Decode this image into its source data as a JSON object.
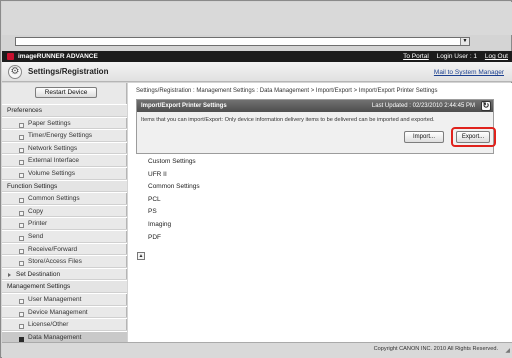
{
  "browser": {
    "dropdown_glyph": "▼"
  },
  "brand": {
    "name": "imageRUNNER ADVANCE",
    "to_portal": "To Portal",
    "login_user": "Login User : 1",
    "log_out": "Log Out"
  },
  "page": {
    "title": "Settings/Registration",
    "mail_link": "Mail to System Manager"
  },
  "sidebar": {
    "restart_label": "Restart Device",
    "items": [
      {
        "label": "Preferences",
        "kind": "header"
      },
      {
        "label": "Paper Settings",
        "kind": "sub"
      },
      {
        "label": "Timer/Energy Settings",
        "kind": "sub"
      },
      {
        "label": "Network Settings",
        "kind": "sub"
      },
      {
        "label": "External Interface",
        "kind": "sub"
      },
      {
        "label": "Volume Settings",
        "kind": "sub"
      },
      {
        "label": "Function Settings",
        "kind": "header"
      },
      {
        "label": "Common Settings",
        "kind": "sub"
      },
      {
        "label": "Copy",
        "kind": "sub"
      },
      {
        "label": "Printer",
        "kind": "sub"
      },
      {
        "label": "Send",
        "kind": "sub"
      },
      {
        "label": "Receive/Forward",
        "kind": "sub"
      },
      {
        "label": "Store/Access Files",
        "kind": "sub"
      },
      {
        "label": "Set Destination",
        "kind": "top"
      },
      {
        "label": "Management Settings",
        "kind": "header"
      },
      {
        "label": "User Management",
        "kind": "sub"
      },
      {
        "label": "Device Management",
        "kind": "sub"
      },
      {
        "label": "License/Other",
        "kind": "sub"
      },
      {
        "label": "Data Management",
        "kind": "sub",
        "active": true
      }
    ]
  },
  "main": {
    "breadcrumb": "Settings/Registration : Management Settings : Data Management > Import/Export > Import/Export Printer Settings",
    "panel": {
      "title": "Import/Export Printer Settings",
      "last_updated": "Last Updated : 02/23/2010 2:44:45 PM",
      "refresh_glyph": "↻",
      "description": "Items that you can import/Export: Only device information delivery items to be delivered can be imported and exported.",
      "import_label": "Import...",
      "export_label": "Export..."
    },
    "settings_items": [
      "Custom Settings",
      "UFR II",
      "Common Settings",
      "PCL",
      "PS",
      "Imaging",
      "PDF"
    ],
    "page_top_glyph": "▲"
  },
  "footer": {
    "copyright": "Copyright CANON INC. 2010 All Rights Reserved."
  },
  "colors": {
    "highlight": "#e0221c",
    "brand_bar": "#1c1c1c",
    "panel_header": "#5a5a5a",
    "link": "#1a3f8f"
  }
}
